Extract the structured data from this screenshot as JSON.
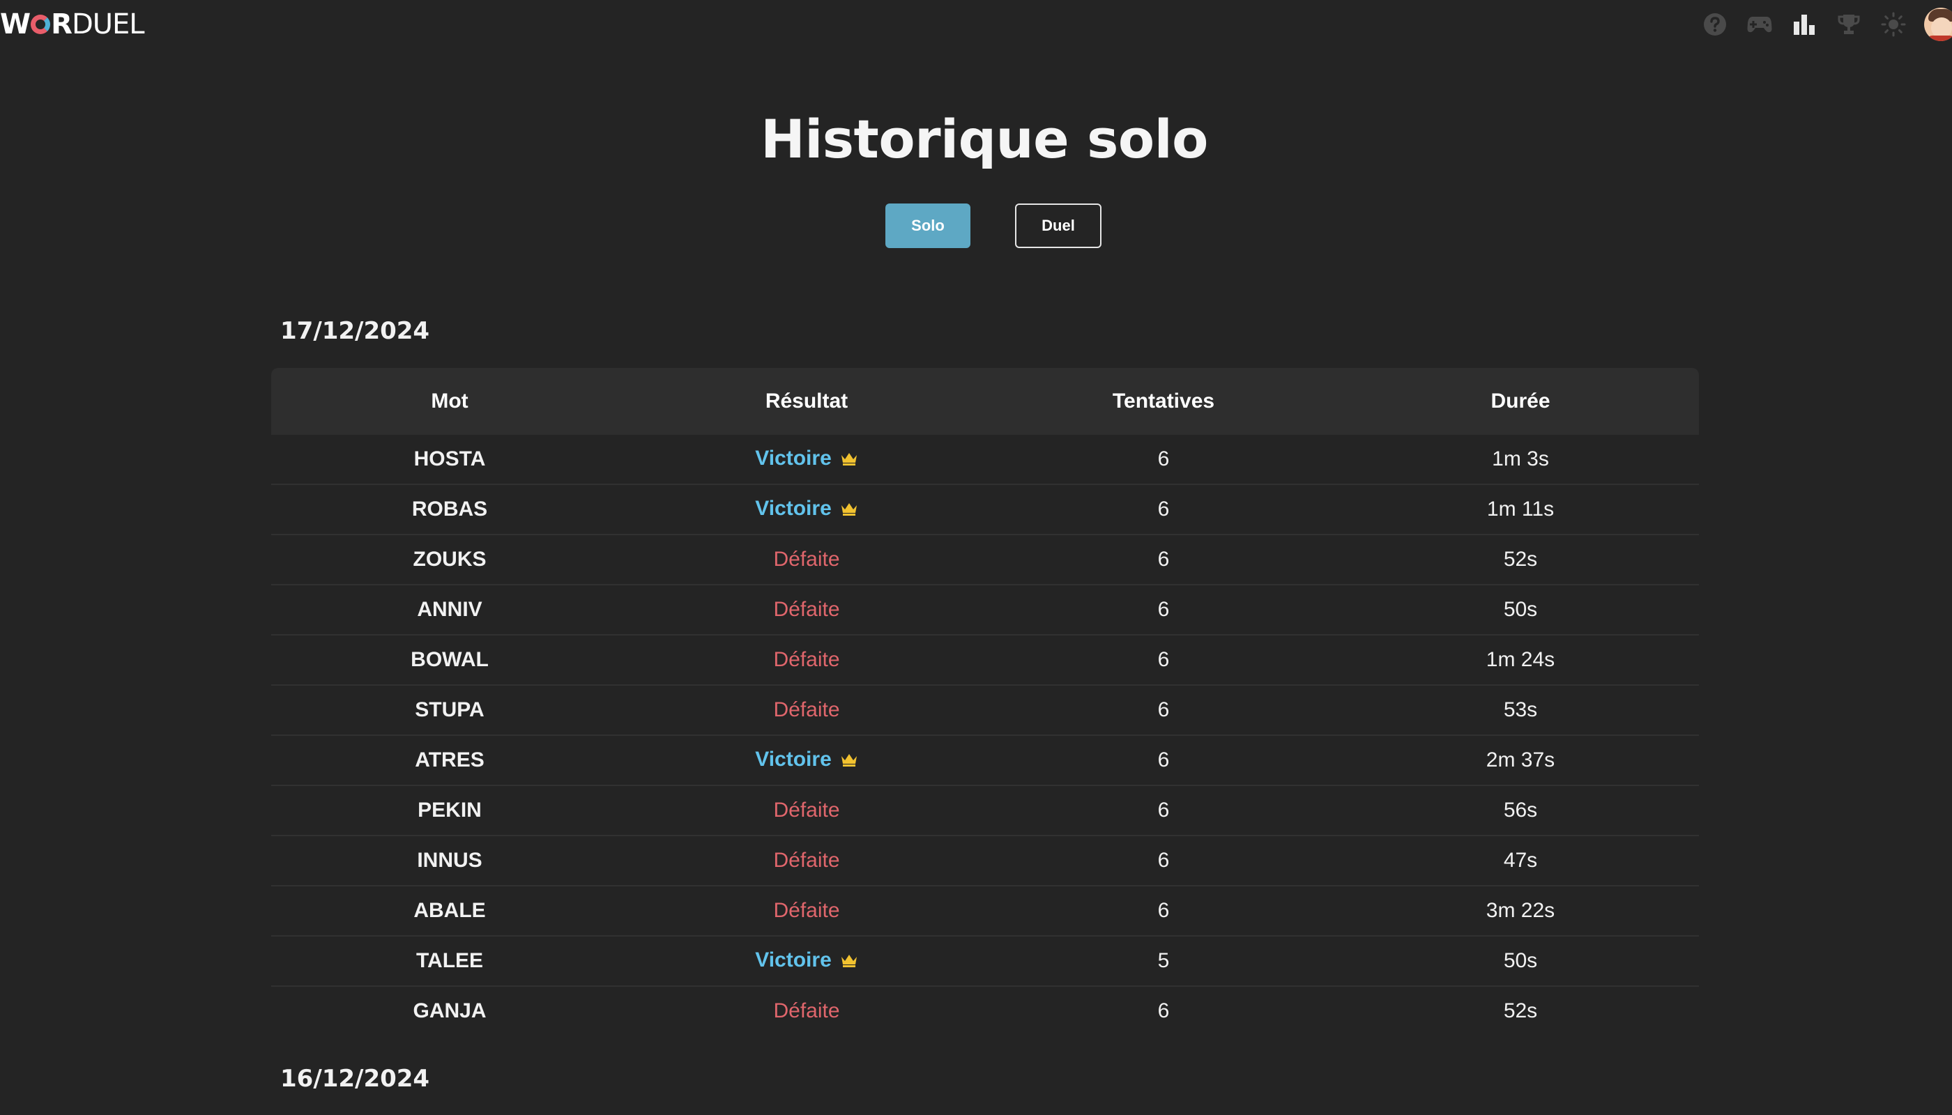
{
  "header": {
    "logo_part1": "W",
    "logo_part2": "R",
    "logo_part3": "DUEL",
    "icons": [
      "help-icon",
      "gamepad-icon",
      "stats-icon",
      "trophy-icon",
      "sun-icon",
      "avatar"
    ]
  },
  "page": {
    "title": "Historique solo"
  },
  "mode_switch": {
    "solo_label": "Solo",
    "duel_label": "Duel",
    "active": "Solo"
  },
  "table": {
    "columns": [
      "Mot",
      "Résultat",
      "Tentatives",
      "Durée"
    ]
  },
  "groups": [
    {
      "date": "17/12/2024",
      "rows": [
        {
          "word": "HOSTA",
          "result": "Victoire",
          "tries": "6",
          "duration": "1m 3s"
        },
        {
          "word": "ROBAS",
          "result": "Victoire",
          "tries": "6",
          "duration": "1m 11s"
        },
        {
          "word": "ZOUKS",
          "result": "Défaite",
          "tries": "6",
          "duration": "52s"
        },
        {
          "word": "ANNIV",
          "result": "Défaite",
          "tries": "6",
          "duration": "50s"
        },
        {
          "word": "BOWAL",
          "result": "Défaite",
          "tries": "6",
          "duration": "1m 24s"
        },
        {
          "word": "STUPA",
          "result": "Défaite",
          "tries": "6",
          "duration": "53s"
        },
        {
          "word": "ATRES",
          "result": "Victoire",
          "tries": "6",
          "duration": "2m 37s"
        },
        {
          "word": "PEKIN",
          "result": "Défaite",
          "tries": "6",
          "duration": "56s"
        },
        {
          "word": "INNUS",
          "result": "Défaite",
          "tries": "6",
          "duration": "47s"
        },
        {
          "word": "ABALE",
          "result": "Défaite",
          "tries": "6",
          "duration": "3m 22s"
        },
        {
          "word": "TALEE",
          "result": "Victoire",
          "tries": "5",
          "duration": "50s"
        },
        {
          "word": "GANJA",
          "result": "Défaite",
          "tries": "6",
          "duration": "52s"
        }
      ]
    },
    {
      "date": "16/12/2024",
      "rows": []
    }
  ],
  "colors": {
    "background": "#242424",
    "victory": "#62c3ec",
    "defeat": "#e0666c",
    "crown": "#f2c230",
    "accent_button": "#5ea8c4"
  }
}
